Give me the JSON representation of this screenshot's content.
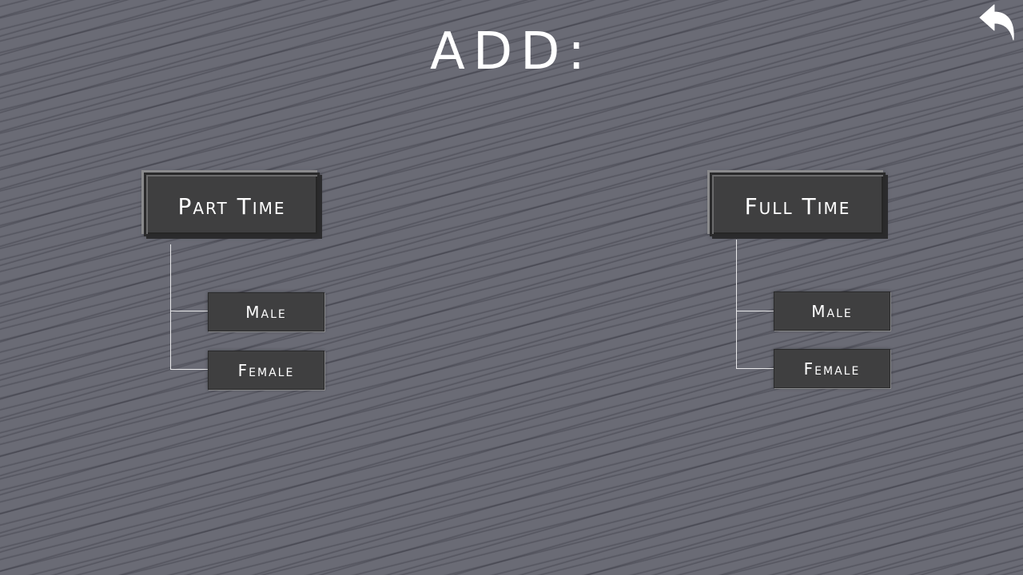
{
  "header": {
    "title": "ADD:"
  },
  "navigation": {
    "back_icon": "undo-arrow-icon"
  },
  "groups": [
    {
      "label": "Part Time",
      "options": [
        "Male",
        "Female"
      ]
    },
    {
      "label": "Full Time",
      "options": [
        "Male",
        "Female"
      ]
    }
  ],
  "colors": {
    "background": "#6a6b75",
    "button": "#3f3f40",
    "text": "#ffffff",
    "connector": "#e8e8ea"
  }
}
